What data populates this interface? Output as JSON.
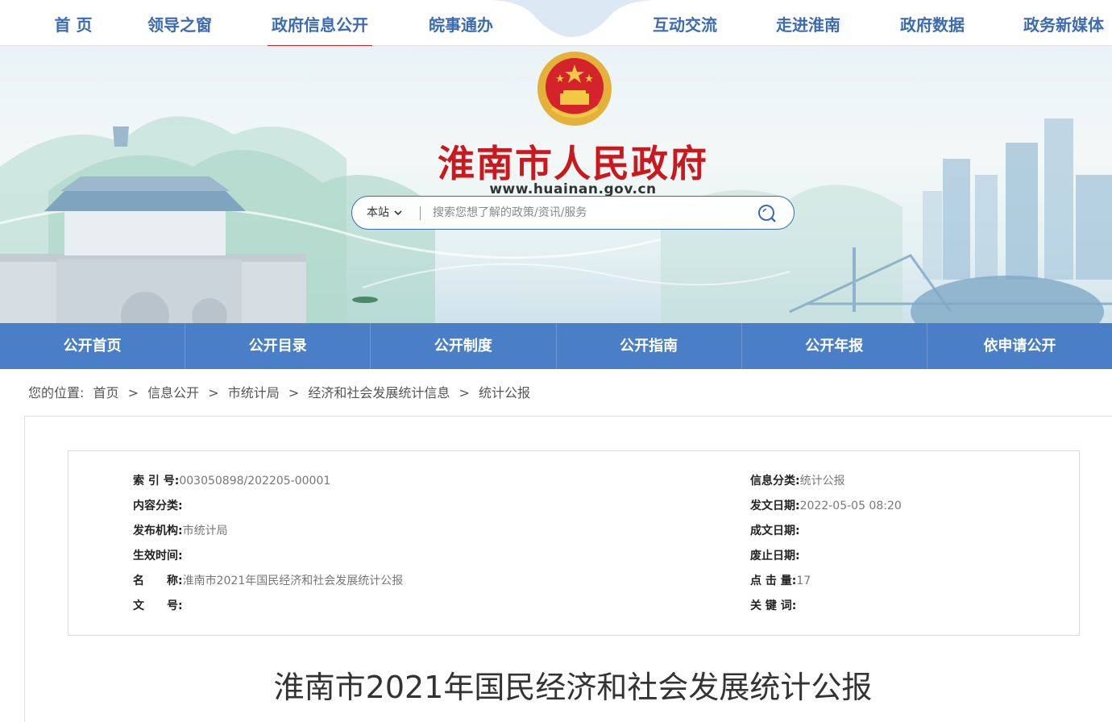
{
  "topnav": {
    "items": [
      {
        "label": "首 页"
      },
      {
        "label": "领导之窗"
      },
      {
        "label": "政府信息公开"
      },
      {
        "label": "皖事通办"
      },
      {
        "label": "互动交流"
      },
      {
        "label": "走进淮南"
      },
      {
        "label": "政府数据"
      },
      {
        "label": "政务新媒体"
      }
    ],
    "active_index": 2
  },
  "header": {
    "site_title": "淮南市人民政府",
    "site_url": "www.huainan.gov.cn"
  },
  "search": {
    "scope_label": "本站",
    "placeholder": "搜索您想了解的政策/资讯/服务"
  },
  "subnav": {
    "items": [
      {
        "label": "公开首页"
      },
      {
        "label": "公开目录"
      },
      {
        "label": "公开制度"
      },
      {
        "label": "公开指南"
      },
      {
        "label": "公开年报"
      },
      {
        "label": "依申请公开"
      }
    ]
  },
  "breadcrumb": {
    "prefix": "您的位置:",
    "items": [
      "首页",
      "信息公开",
      "市统计局",
      "经济和社会发展统计信息",
      "统计公报"
    ],
    "separator": ">"
  },
  "meta": {
    "left": [
      {
        "label": "索 引 号:",
        "value": "003050898/202205-00001"
      },
      {
        "label": "内容分类:",
        "value": ""
      },
      {
        "label": "发布机构:",
        "value": "市统计局"
      },
      {
        "label": "生效时间:",
        "value": ""
      },
      {
        "label": "名　　称:",
        "value": "淮南市2021年国民经济和社会发展统计公报"
      },
      {
        "label": "文　　号:",
        "value": ""
      }
    ],
    "right": [
      {
        "label": "信息分类:",
        "value": "统计公报"
      },
      {
        "label": "发文日期:",
        "value": "2022-05-05 08:20"
      },
      {
        "label": "成文日期:",
        "value": ""
      },
      {
        "label": "废止日期:",
        "value": ""
      },
      {
        "label": "点 击 量:",
        "value": "17"
      },
      {
        "label": "关 键 词:",
        "value": ""
      }
    ]
  },
  "article": {
    "title": "淮南市2021年国民经济和社会发展统计公报"
  },
  "colors": {
    "nav_blue": "#3c6bb5",
    "subnav_bg": "#4a7fc8",
    "title_red": "#c9191e",
    "active_underline": "#c9252b"
  }
}
